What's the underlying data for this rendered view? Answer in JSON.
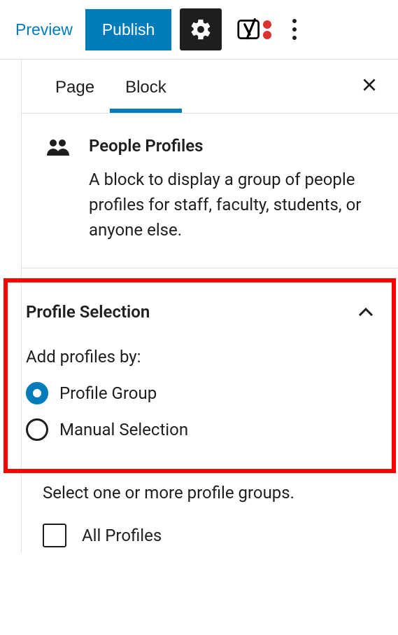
{
  "toolbar": {
    "preview": "Preview",
    "publish": "Publish"
  },
  "tabs": {
    "page": "Page",
    "block": "Block"
  },
  "block": {
    "title": "People Profiles",
    "description": "A block to display a group of people profiles for staff, faculty, students, or anyone else."
  },
  "panel": {
    "title": "Profile Selection",
    "field_label": "Add profiles by:",
    "options": {
      "group": "Profile Group",
      "manual": "Manual Selection"
    }
  },
  "groups": {
    "help": "Select one or more profile groups.",
    "all": "All Profiles"
  }
}
